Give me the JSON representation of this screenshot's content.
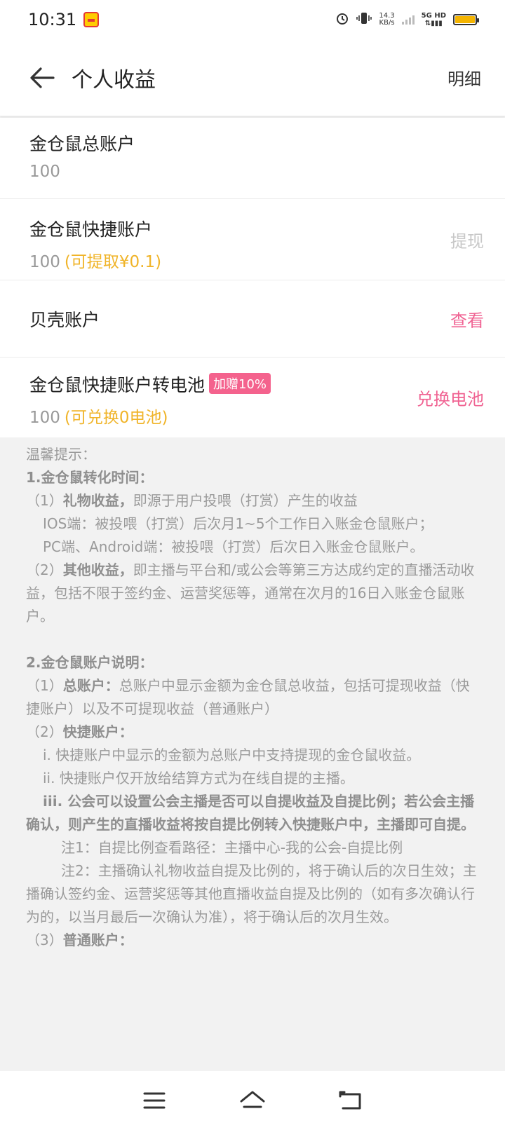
{
  "status_bar": {
    "time": "10:31",
    "net_speed_value": "14.3",
    "net_speed_unit": "KB/s",
    "network_type": "5G HD",
    "battery_color": "#f4b400"
  },
  "header": {
    "title": "个人收益",
    "detail_label": "明细"
  },
  "accounts": [
    {
      "title": "金仓鼠总账户",
      "value": "100"
    },
    {
      "title": "金仓鼠快捷账户",
      "value": "100",
      "hint": "(可提取¥0.1)",
      "action": "提现"
    },
    {
      "title": "贝壳账户",
      "action": "查看"
    },
    {
      "title": "金仓鼠快捷账户转电池",
      "badge": "加赠10%",
      "value": "100",
      "hint": "(可兑换0电池)",
      "action": "兑换电池"
    }
  ],
  "colors": {
    "accent_pink": "#f06292",
    "hint_yellow": "#f0b429",
    "disabled_gray": "#c8c8c8"
  },
  "tips": {
    "heading": "温馨提示：",
    "s1_title": "1.金仓鼠转化时间：",
    "s1_p1_prefix": "（1）",
    "s1_p1_bold": "礼物收益，",
    "s1_p1_rest": "即源于用户投喂（打赏）产生的收益",
    "s1_p2": "IOS端：被投喂（打赏）后次月1~5个工作日入账金仓鼠账户；",
    "s1_p3": "PC端、Android端：被投喂（打赏）后次日入账金仓鼠账户。",
    "s1_p4_prefix": "（2）",
    "s1_p4_bold": "其他收益，",
    "s1_p4_rest": "即主播与平台和/或公会等第三方达成约定的直播活动收益，包括不限于签约金、运营奖惩等，通常在次月的16日入账金仓鼠账户。",
    "s2_title": "2.金仓鼠账户说明：",
    "s2_p1_prefix": "（1）",
    "s2_p1_bold": "总账户：",
    "s2_p1_rest": "总账户中显示金额为金仓鼠总收益，包括可提现收益（快捷账户）以及不可提现收益（普通账户）",
    "s2_p2_prefix": "（2）",
    "s2_p2_bold": "快捷账户：",
    "s2_p3": "i. 快捷账户中显示的金额为总账户中支持提现的金仓鼠收益。",
    "s2_p4": "ii. 快捷账户仅开放给结算方式为在线自提的主播。",
    "s2_p5_bold": "iii. 公会可以设置公会主播是否可以自提收益及自提比例；若公会主播确认，则产生的直播收益将按自提比例转入快捷账户中，主播即可自提。",
    "s2_note1": "注1：自提比例查看路径：主播中心-我的公会-自提比例",
    "s2_note2": "注2：主播确认礼物收益自提及比例的，将于确认后的次日生效；主播确认签约金、运营奖惩等其他直播收益自提及比例的（如有多次确认行为的，以当月最后一次确认为准），将于确认后的次月生效。",
    "s2_p6_prefix": "（3）",
    "s2_p6_bold": "普通账户："
  }
}
